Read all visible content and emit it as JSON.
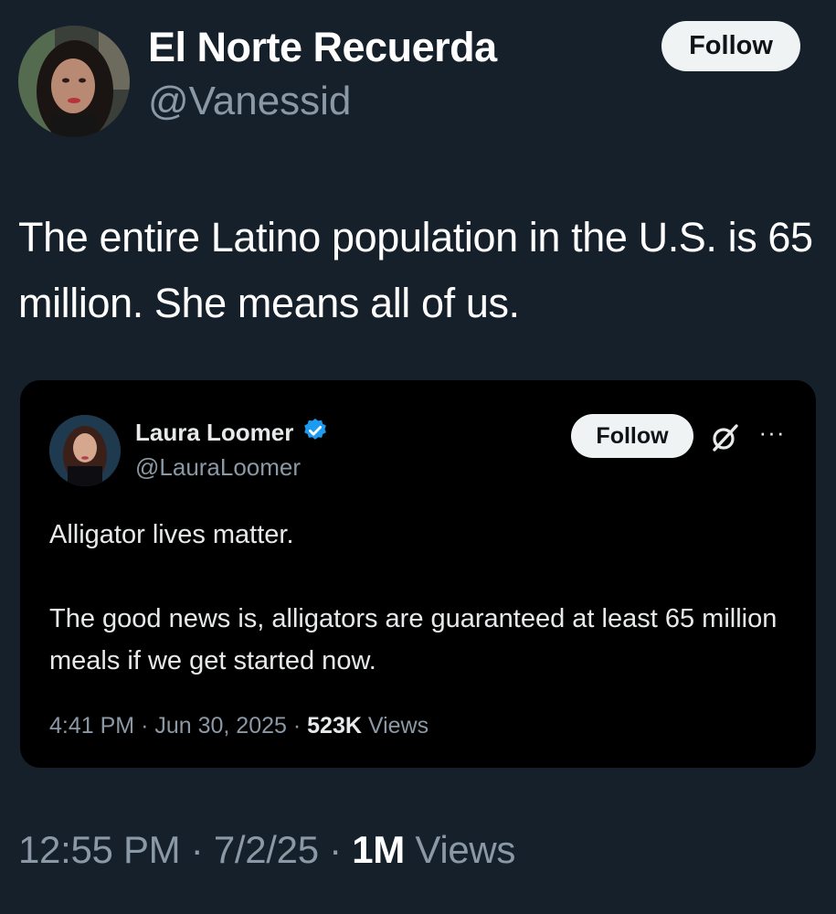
{
  "author": {
    "display_name": "El Norte Recuerda",
    "handle": "@Vanessid",
    "follow_label": "Follow"
  },
  "tweet": {
    "text": "The entire Latino population in the U.S. is 65 million. She means all of us.",
    "time": "12:55 PM",
    "date": "7/2/25",
    "views_count": "1M",
    "views_label": "Views",
    "separator": "·"
  },
  "quoted": {
    "display_name": "Laura Loomer",
    "handle": "@LauraLoomer",
    "verified_color": "#1d9bf0",
    "follow_label": "Follow",
    "paragraph_1": "Alligator lives matter.",
    "paragraph_2": "The good news is, alligators are guaranteed at least 65 million meals if we get started now.",
    "time": "4:41 PM",
    "date": "Jun 30, 2025",
    "views_count": "523K",
    "views_label": "Views",
    "separator": "·",
    "more_label": "···"
  },
  "icons": {
    "verified": "verified-badge-icon",
    "grok": "grok-icon",
    "more": "more-icon"
  }
}
